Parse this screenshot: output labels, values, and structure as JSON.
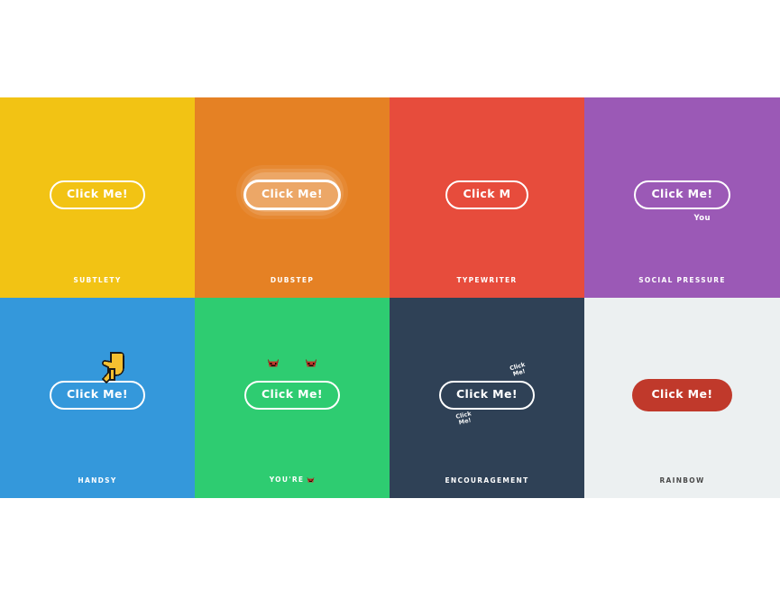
{
  "page": {
    "background": "#ffffff",
    "default_button_label": "Click Me!"
  },
  "gallery": {
    "columns": 4,
    "rows": 2,
    "cells": [
      {
        "id": "subtlety",
        "caption": "SUBTLETY",
        "background": "#f2c314",
        "button_label": "Click Me!",
        "button_style": "outline",
        "button_text_color": "#ffffff",
        "button_border_color": "#ffffff"
      },
      {
        "id": "dubstep",
        "caption": "DUBSTEP",
        "background": "#e58124",
        "button_label": "Click Me!",
        "button_style": "outline-glow",
        "button_text_color": "#ffffff",
        "button_border_color": "#ffffff",
        "glow_color": "rgba(255,255,255,0.15)"
      },
      {
        "id": "typewriter",
        "caption": "TYPEWRITER",
        "background": "#e74c3c",
        "button_label": "Click M",
        "button_style": "outline",
        "button_text_color": "#ffffff",
        "button_border_color": "#ffffff"
      },
      {
        "id": "social-pressure",
        "caption": "SOCIAL PRESSURE",
        "background": "#9b59b6",
        "button_label": "Click Me!",
        "button_style": "outline",
        "button_text_color": "#ffffff",
        "button_border_color": "#ffffff",
        "note": "You"
      },
      {
        "id": "handsy",
        "caption": "HANDSY",
        "background": "#3498db",
        "button_label": "Click Me!",
        "button_style": "outline",
        "button_text_color": "#ffffff",
        "button_border_color": "#ffffff",
        "decoration_icon": "pointing-down-hand-icon"
      },
      {
        "id": "youre-devil",
        "caption": "YOU'RE",
        "caption_emoji": "devil-face-icon",
        "background": "#2ecc71",
        "button_label": "Click Me!",
        "button_style": "outline",
        "button_text_color": "#ffffff",
        "button_border_color": "#ffffff",
        "decoration_icons": [
          "devil-face-icon",
          "devil-face-icon"
        ]
      },
      {
        "id": "encouragement",
        "caption": "ENCOURAGEMENT",
        "background": "#2f4156",
        "button_label": "Click Me!",
        "button_style": "outline",
        "button_text_color": "#ffffff",
        "button_border_color": "#ffffff",
        "ghosts": [
          "Click Me!",
          "Click Me!"
        ]
      },
      {
        "id": "rainbow",
        "caption": "RAINBOW",
        "background": "#ecf0f1",
        "button_label": "Click Me!",
        "button_style": "filled",
        "button_text_color": "#ffffff",
        "button_fill_color": "#c0392b",
        "caption_color": "#4a4a4a"
      }
    ]
  }
}
